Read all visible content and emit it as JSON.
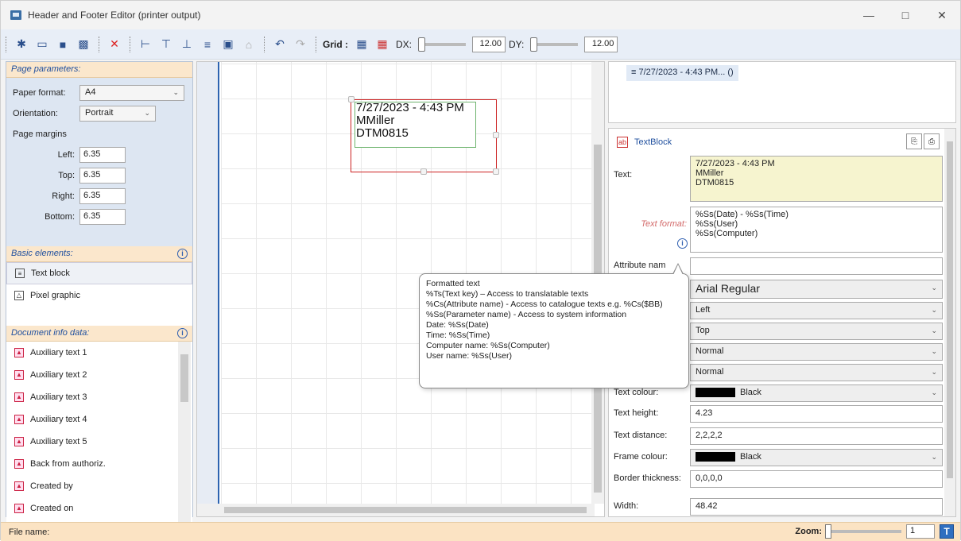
{
  "window": {
    "title": "Header and Footer Editor (printer output)"
  },
  "toolbar": {
    "grid_label": "Grid :",
    "dx_label": "DX:",
    "dx_value": "12.00",
    "dy_label": "DY:",
    "dy_value": "12.00",
    "icons": [
      "new-icon",
      "open-icon",
      "save-icon",
      "save-as-icon",
      "delete-icon",
      "align-left-icon",
      "align-top-icon",
      "align-bottom-icon",
      "align-center-icon",
      "size-icon",
      "lock-icon",
      "undo-icon",
      "redo-icon",
      "grid-icon",
      "grid-snap-icon"
    ]
  },
  "page_params": {
    "header": "Page parameters:",
    "paper_format_label": "Paper format:",
    "paper_format_value": "A4",
    "orientation_label": "Orientation:",
    "orientation_value": "Portrait",
    "margins_label": "Page margins",
    "margins": [
      {
        "label": "Left:",
        "value": "6.35"
      },
      {
        "label": "Top:",
        "value": "6.35"
      },
      {
        "label": "Right:",
        "value": "6.35"
      },
      {
        "label": "Bottom:",
        "value": "6.35"
      }
    ]
  },
  "basic_elements": {
    "header": "Basic elements:",
    "items": [
      "Text block",
      "Pixel graphic"
    ]
  },
  "doc_info": {
    "header": "Document info data:",
    "items": [
      "Auxiliary text 1",
      "Auxiliary text 2",
      "Auxiliary text 3",
      "Auxiliary text 4",
      "Auxiliary text 5",
      "Back from authoriz.",
      "Created by",
      "Created on"
    ]
  },
  "canvas": {
    "text_line1": "7/27/2023 - 4:43 PM",
    "text_line2": "MMiller",
    "text_line3": "DTM0815"
  },
  "element_tree": {
    "item": "7/27/2023 - 4:43 PM... ()"
  },
  "props": {
    "type_label": "TextBlock",
    "text_label": "Text:",
    "text_value_1": "7/27/2023 - 4:43 PM",
    "text_value_2": "MMiller",
    "text_value_3": "DTM0815",
    "format_label": "Text format:",
    "format_1": "%Ss(Date) - %Ss(Time)",
    "format_2": "%Ss(User)",
    "format_3": "%Ss(Computer)",
    "attr_label": "Attribute nam",
    "font_value": "Arial Regular",
    "halign_value": "Left",
    "valign_value": "Top",
    "style1_value": "Normal",
    "style2_value": "Normal",
    "text_colour_label": "Text colour:",
    "text_colour_value": "Black",
    "text_height_label": "Text height:",
    "text_height_value": "4.23",
    "text_distance_label": "Text distance:",
    "text_distance_value": "2,2,2,2",
    "frame_colour_label": "Frame colour:",
    "frame_colour_value": "Black",
    "border_label": "Border thickness:",
    "border_value": "0,0,0,0",
    "width_label": "Width:",
    "width_value": "48.42"
  },
  "tooltip": {
    "lines": [
      "Formatted text",
      "%Ts(Text key) – Access to translatable texts",
      "%Cs(Attribute name) - Access to catalogue texts e.g. %Cs($BB)",
      "%Ss(Parameter name) - Access to system information",
      "Date:  %Ss(Date)",
      "Time:  %Ss(Time)",
      "Computer name: %Ss(Computer)",
      "User name: %Ss(User)"
    ]
  },
  "status": {
    "file_name_label": "File name:",
    "zoom_label": "Zoom:",
    "zoom_value": "1"
  },
  "colors": {
    "accent": "#2d63b0",
    "section_header": "#fbe7cc",
    "selection_frame": "#cc2222"
  }
}
